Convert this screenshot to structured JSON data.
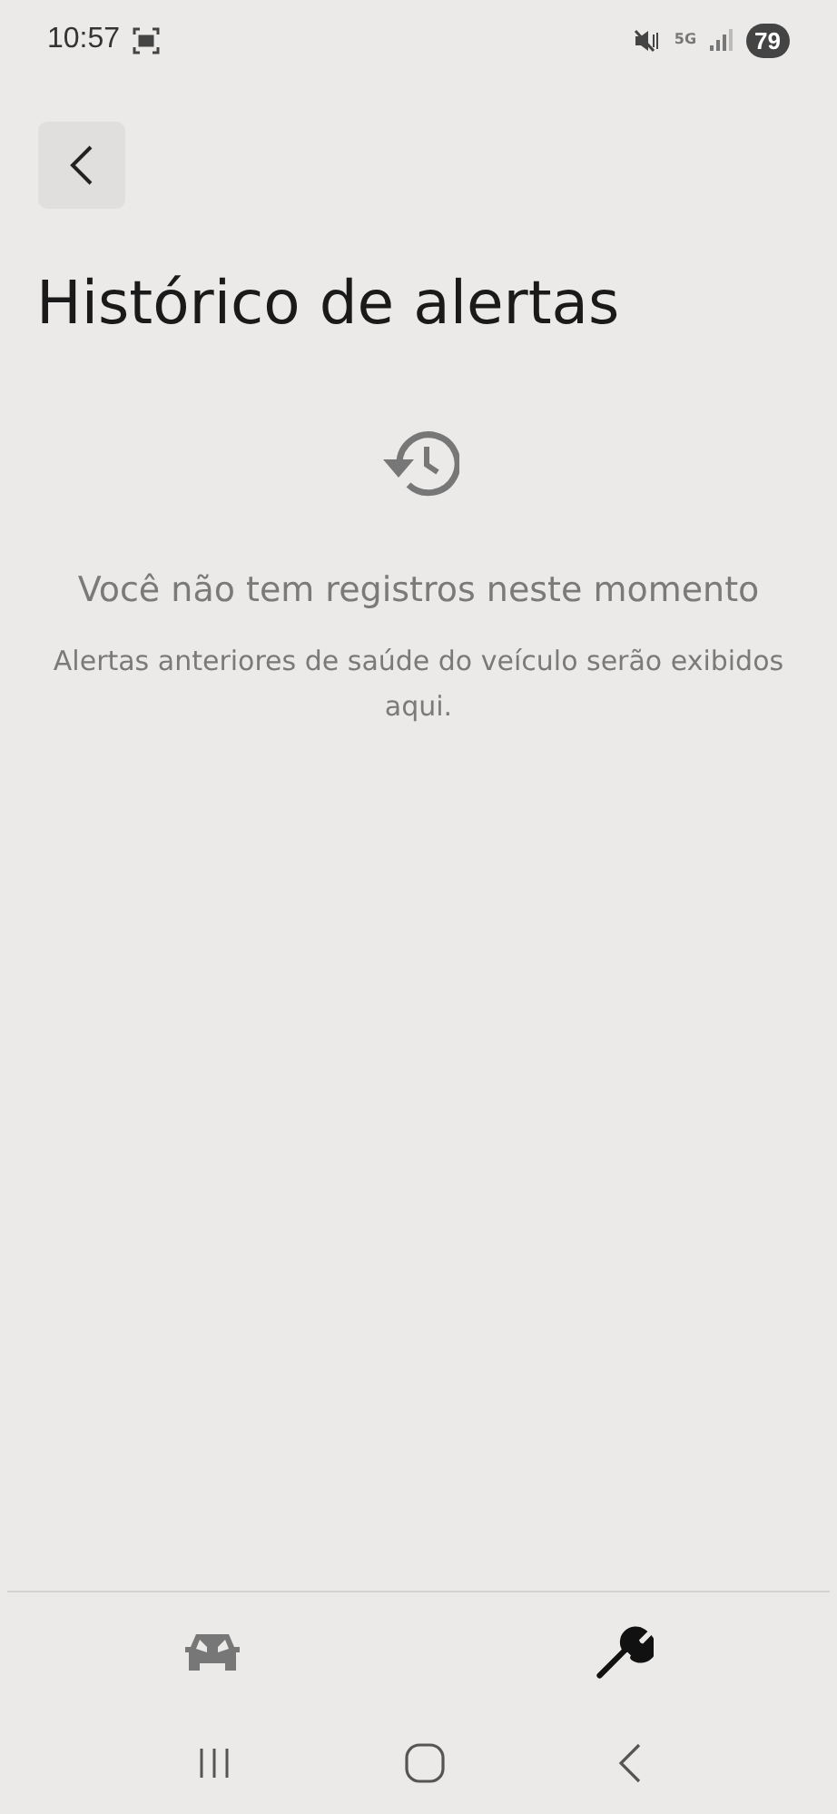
{
  "status_bar": {
    "time": "10:57",
    "network": "5G",
    "battery": "79"
  },
  "title": "Histórico de alertas",
  "empty_state": {
    "heading": "Você não tem registros neste momento",
    "message": "Alertas anteriores de saúde do veículo serão exibidos aqui."
  },
  "bottom_tabs": [
    {
      "kind": "car",
      "selected": false
    },
    {
      "kind": "wrench",
      "selected": true
    }
  ]
}
